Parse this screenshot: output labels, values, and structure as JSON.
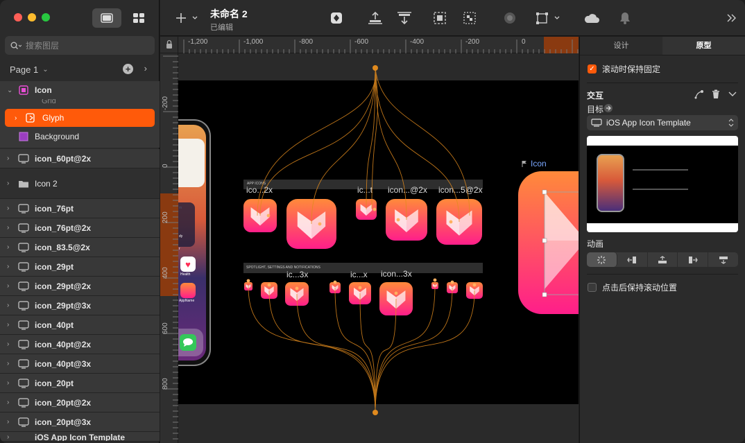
{
  "toolbar": {
    "doc_name": "未命名 2",
    "doc_status": "已编辑"
  },
  "sidebar": {
    "search_placeholder": "搜索图层",
    "page_label": "Page 1",
    "layers": [
      {
        "label": "Icon"
      },
      {
        "label": "Grid"
      },
      {
        "label": "Glyph"
      },
      {
        "label": "Background"
      },
      {
        "label": "icon_60pt@2x"
      },
      {
        "label": "Icon 2"
      },
      {
        "label": "icon_76pt"
      },
      {
        "label": "icon_76pt@2x"
      },
      {
        "label": "icon_83.5@2x"
      },
      {
        "label": "icon_29pt"
      },
      {
        "label": "icon_29pt@2x"
      },
      {
        "label": "icon_29pt@3x"
      },
      {
        "label": "icon_40pt"
      },
      {
        "label": "icon_40pt@2x"
      },
      {
        "label": "icon_40pt@3x"
      },
      {
        "label": "icon_20pt"
      },
      {
        "label": "icon_20pt@2x"
      },
      {
        "label": "icon_20pt@3x"
      },
      {
        "label": "iOS App Icon Template"
      }
    ]
  },
  "canvas": {
    "ruler_top": [
      "-1,200",
      "-1,000",
      "-800",
      "-600",
      "-400",
      "-200",
      "0"
    ],
    "ruler_left": [
      "-200",
      "0",
      "200",
      "400",
      "600",
      "800"
    ],
    "section_app_icons": "APP ICONS",
    "section_spotlight": "SPOTLIGHT, SETTINGS AND NOTIFICATIONS",
    "row1_labels": [
      "ico...2x",
      "ic...t",
      "icon...@2x",
      "icon...5@2x"
    ],
    "row2_labels": [
      "ic...3x",
      "ic...x",
      "icon...3x"
    ],
    "icon_artboard_label": "Icon",
    "phone_app_labels": [
      "Health",
      "AppName"
    ],
    "phone_widget_text": [
      "m",
      "dy",
      "r"
    ]
  },
  "rpanel": {
    "tab_design": "设计",
    "tab_prototype": "原型",
    "fix_on_scroll": "滚动时保持固定",
    "interaction_title": "交互",
    "target_label": "目标",
    "target_value": "iOS App Icon Template",
    "animation_label": "动画",
    "keep_scroll": "点击后保持滚动位置"
  },
  "colors": {
    "accent": "#ff5a0a",
    "selection_orange": "#ff5a0a",
    "flow_line": "#e08a1e",
    "icon_gradient_top": "#ff8a3a",
    "icon_gradient_bottom": "#ff1e8a"
  }
}
